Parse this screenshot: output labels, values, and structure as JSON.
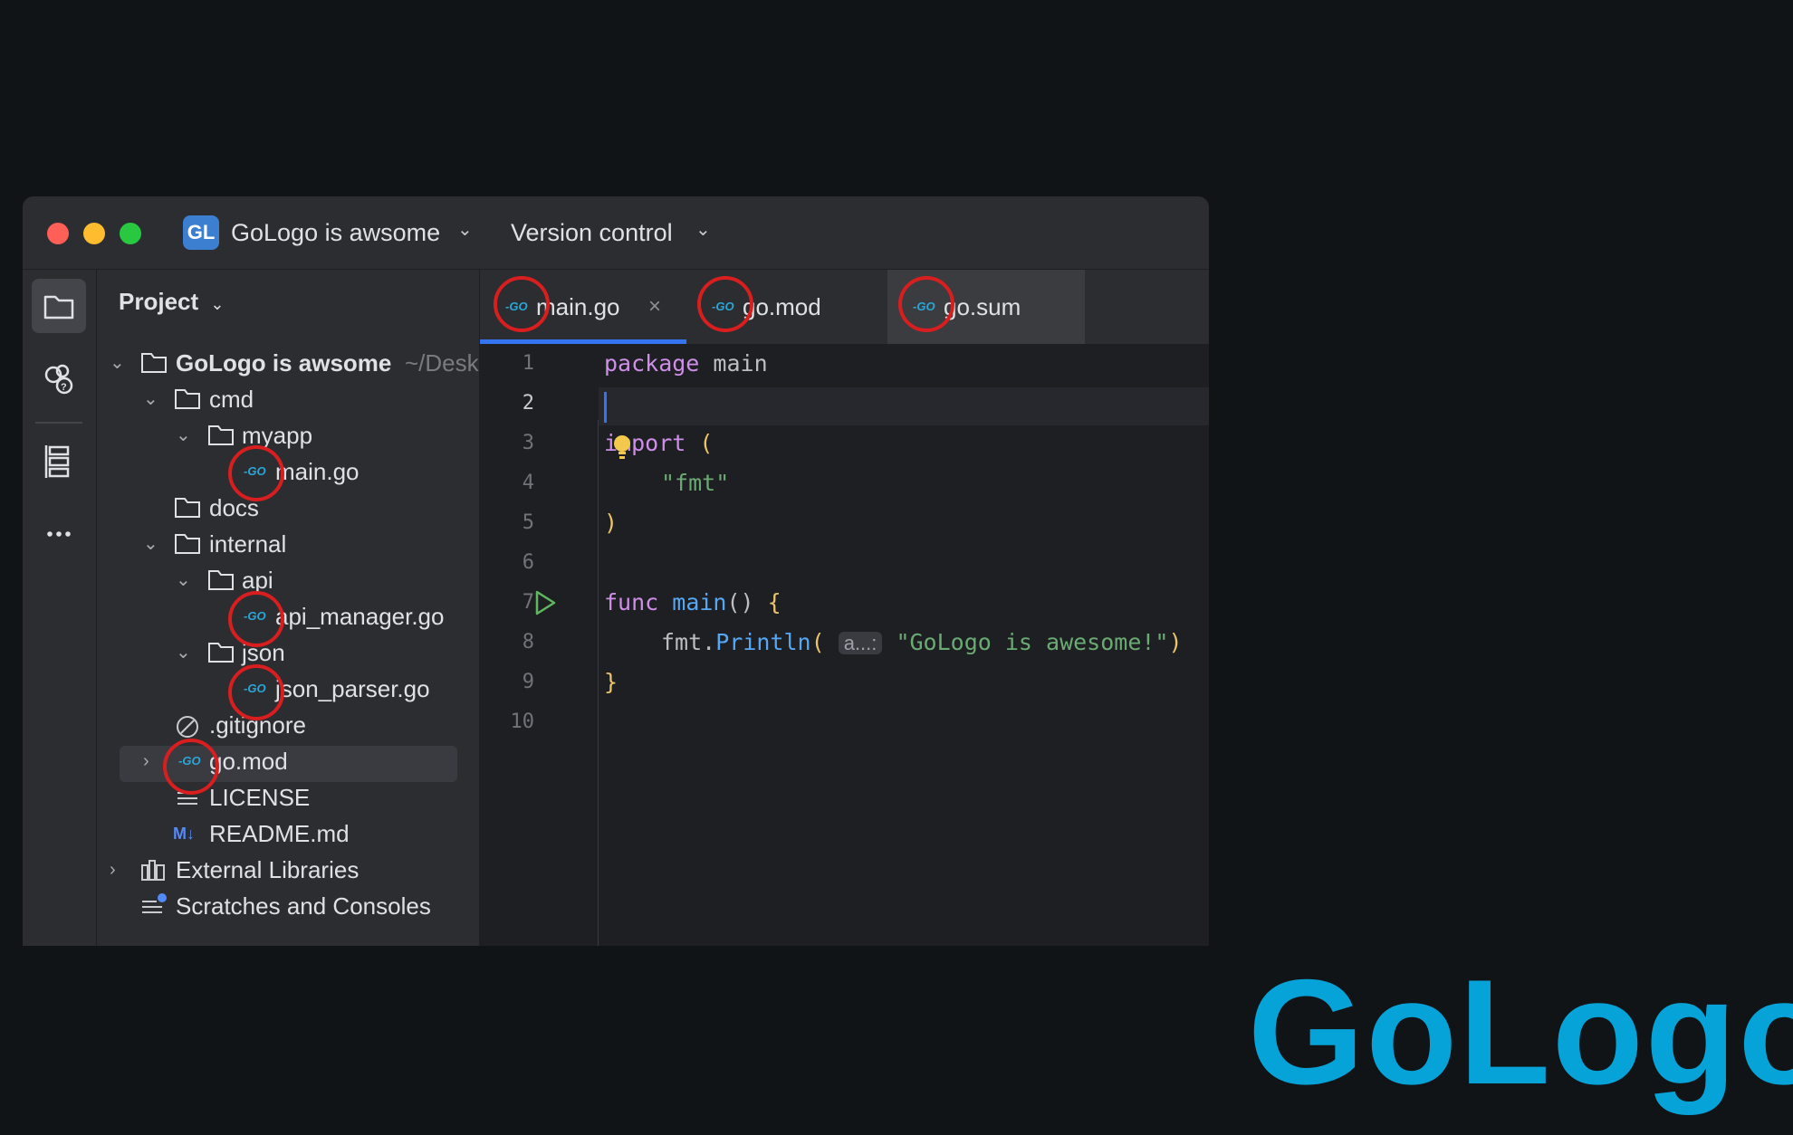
{
  "window": {
    "project_badge": "GL",
    "project_name": "GoLogo is awsome",
    "vcs_label": "Version control"
  },
  "sidebar_tools": [
    "folder-icon",
    "plugins-icon",
    "structure-icon",
    "more-icon"
  ],
  "project_panel": {
    "header": "Project",
    "tree": {
      "root_name": "GoLogo is awsome",
      "root_path": "~/Desk",
      "cmd": "cmd",
      "myapp": "myapp",
      "main_go": "main.go",
      "docs": "docs",
      "internal": "internal",
      "api": "api",
      "api_manager": "api_manager.go",
      "json": "json",
      "json_parser": "json_parser.go",
      "gitignore": ".gitignore",
      "go_mod": "go.mod",
      "license": "LICENSE",
      "readme": "README.md",
      "external_libraries": "External Libraries",
      "scratches": "Scratches and Consoles"
    }
  },
  "editor": {
    "tabs": [
      {
        "label": "main.go",
        "active": true
      },
      {
        "label": "go.mod",
        "active": false
      },
      {
        "label": "go.sum",
        "active": false
      }
    ],
    "line_numbers": [
      "1",
      "2",
      "3",
      "4",
      "5",
      "6",
      "7",
      "8",
      "9",
      "10"
    ],
    "code": {
      "l1_kw": "package",
      "l1_rest": " main",
      "l3_kw": "import",
      "l3_paren": "(",
      "l4_str": "\"fmt\"",
      "l5_paren": ")",
      "l7_kw": "func",
      "l7_fn": "main",
      "l7_rest": "() ",
      "l7_brace": "{",
      "l8_pkg": "fmt.",
      "l8_fn": "Println",
      "l8_open": "(",
      "l8_hint": "a...:",
      "l8_str": "\"GoLogo is awesome!\"",
      "l8_close": ")",
      "l9_brace": "}"
    }
  },
  "logo_text": "GoLogo",
  "colors": {
    "background": "#111416",
    "accent": "#3574f0",
    "logo": "#06a3d8",
    "annotation_circle": "#d81e1e"
  }
}
